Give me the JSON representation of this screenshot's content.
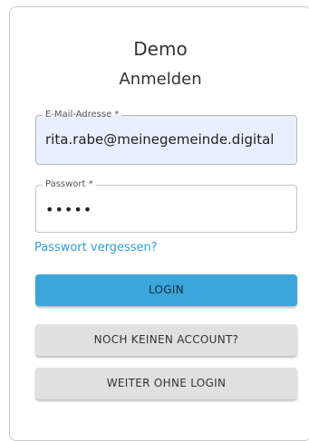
{
  "header": {
    "title": "Demo",
    "subtitle": "Anmelden"
  },
  "form": {
    "email": {
      "label": "E-Mail-Adresse *",
      "value": "rita.rabe@meinegemeinde.digital"
    },
    "password": {
      "label": "Passwort *",
      "value": "•••••"
    },
    "forgot_password_link": "Passwort vergessen?"
  },
  "buttons": {
    "login": "LOGIN",
    "signup": "NOCH KEINEN ACCOUNT?",
    "guest": "WEITER OHNE LOGIN"
  },
  "colors": {
    "primary": "#3aa6dc",
    "link": "#2d9fd9",
    "autofill_background": "#e8f0fe",
    "secondary_button": "#e0e0e0"
  }
}
